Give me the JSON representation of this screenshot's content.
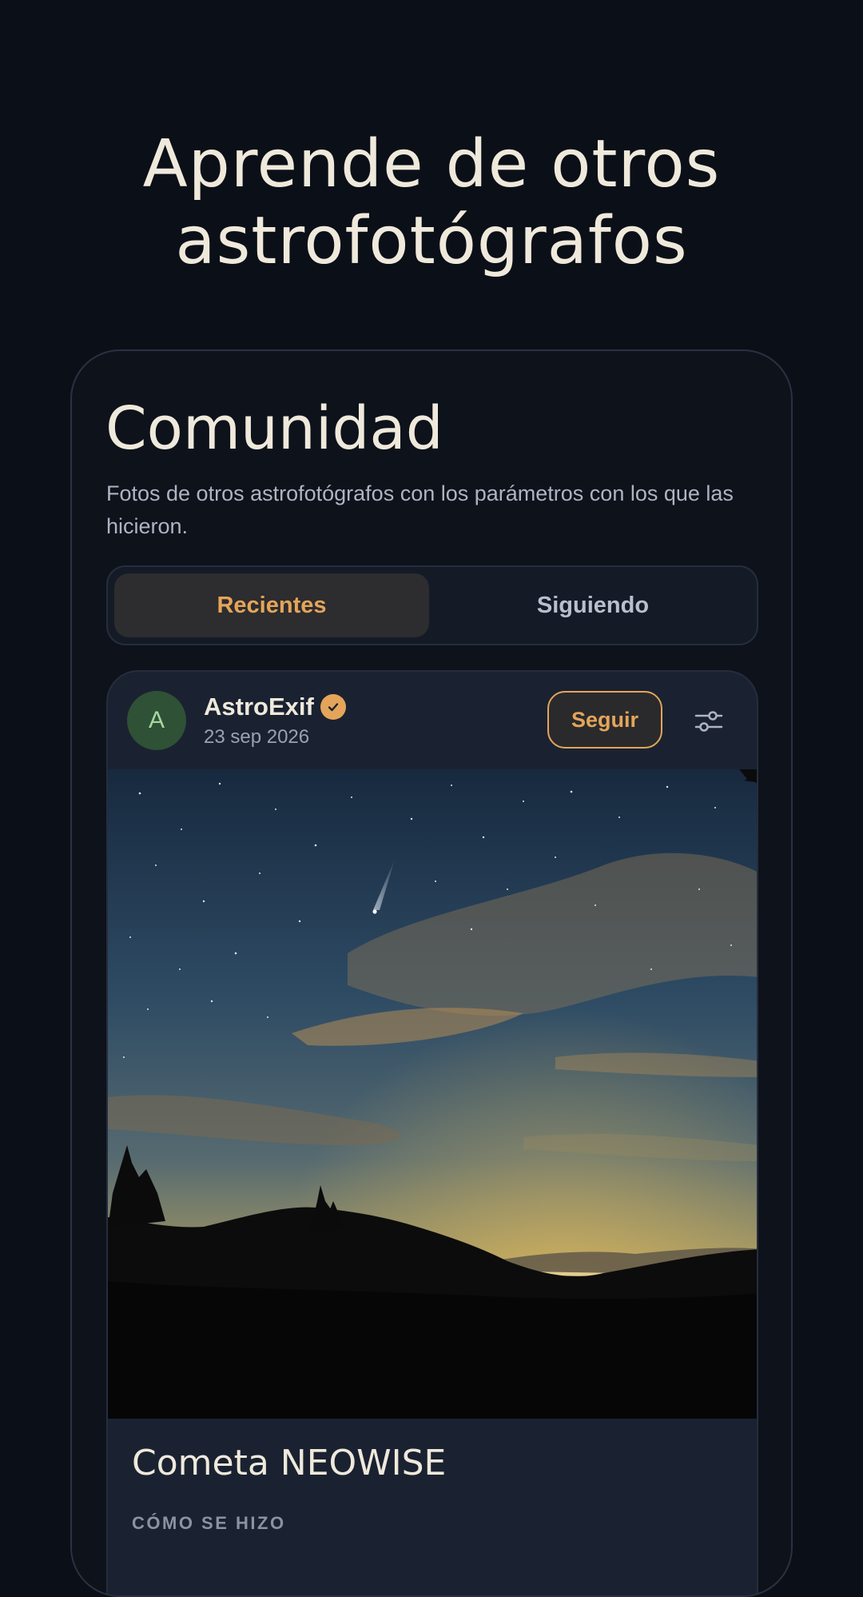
{
  "hero": {
    "title_line1": "Aprende de otros",
    "title_line2": "astrofotógrafos"
  },
  "screen": {
    "title": "Comunidad",
    "subtitle": "Fotos de otros astrofotógrafos con los parámetros con los que las hicieron.",
    "tabs": [
      {
        "label": "Recientes",
        "active": true
      },
      {
        "label": "Siguiendo",
        "active": false
      }
    ]
  },
  "post": {
    "avatar_initial": "A",
    "author": "AstroExif",
    "verified": true,
    "date": "23 sep 2026",
    "follow_label": "Seguir",
    "photo_subject": "comet over mountain silhouette at dusk",
    "title": "Cometa NEOWISE",
    "section_label": "CÓMO SE HIZO"
  },
  "colors": {
    "background": "#0b0f17",
    "accent": "#e4a55a",
    "text": "#efe9dc",
    "muted": "#aeb4c2",
    "avatar_bg": "#2f5136"
  },
  "icons": {
    "verified": "check-badge-icon",
    "filter": "sliders-icon"
  }
}
